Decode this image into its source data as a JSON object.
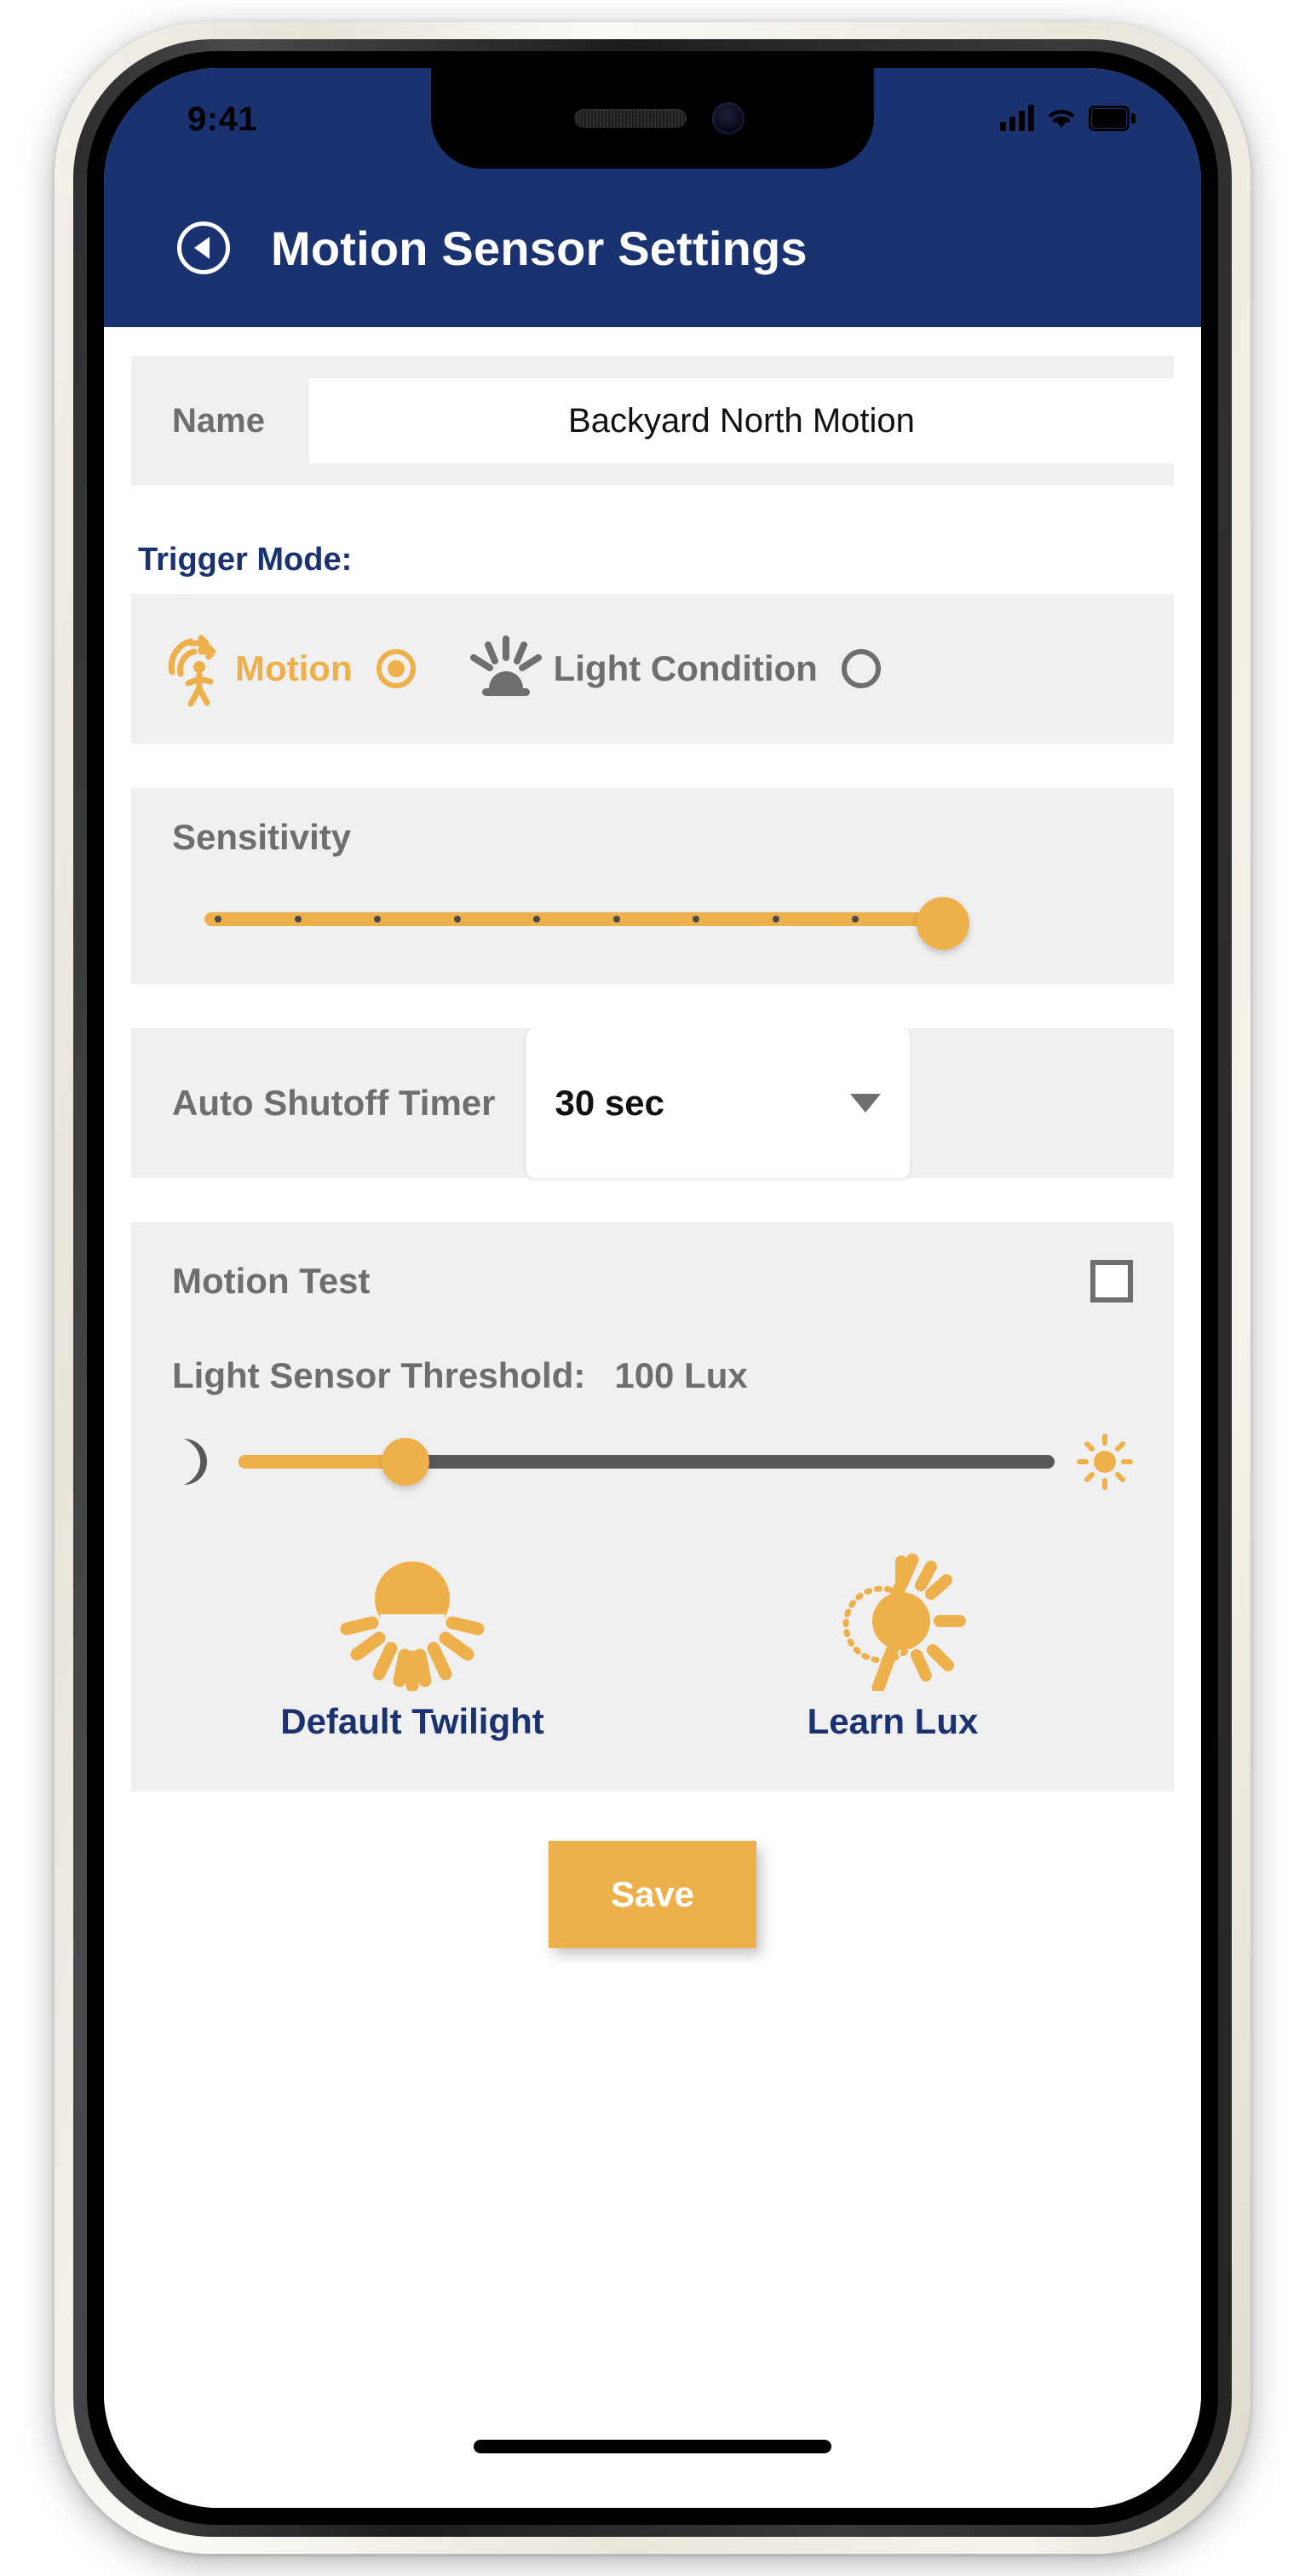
{
  "status_bar": {
    "time": "9:41",
    "signal_icon": "cellular-signal-icon",
    "wifi_icon": "wifi-icon",
    "battery_icon": "battery-full-icon"
  },
  "header": {
    "back_icon": "back-chevron-icon",
    "title": "Motion Sensor Settings",
    "background_color": "#1a3270"
  },
  "name_row": {
    "label": "Name",
    "value": "Backyard North Motion",
    "placeholder": "Backyard North Motion"
  },
  "trigger_mode": {
    "section_label": "Trigger Mode:",
    "options": [
      {
        "label": "Motion",
        "icon": "walking-person-motion-icon",
        "selected": true,
        "color": "#eeb04a"
      },
      {
        "label": "Light Condition",
        "icon": "sunrise-icon",
        "selected": false,
        "color": "#6e6e6e"
      }
    ]
  },
  "sensitivity": {
    "label": "Sensitivity",
    "value_percent": 100,
    "tick_count": 10,
    "track_color": "#eeb04a"
  },
  "auto_shutoff": {
    "label": "Auto Shutoff Timer",
    "value": "30 sec",
    "caret_icon": "chevron-down-icon"
  },
  "motion_test": {
    "label": "Motion Test",
    "checked": false,
    "checkbox_icon": "checkbox-unchecked-icon"
  },
  "light_threshold": {
    "label": "Light Sensor Threshold:",
    "value": "100 Lux",
    "slider_percent": 20,
    "min_icon": "moon-icon",
    "max_icon": "sun-icon",
    "fill_color": "#eeb04a",
    "track_color": "#585858"
  },
  "threshold_actions": [
    {
      "label": "Default Twilight",
      "icon": "dusk-sun-icon"
    },
    {
      "label": "Learn Lux",
      "icon": "sun-clock-learn-icon"
    }
  ],
  "save": {
    "label": "Save",
    "background_color": "#eeb04a"
  },
  "theme": {
    "navy": "#1a3270",
    "orange": "#eeb04a",
    "gray_text": "#6e6e6e",
    "card_bg": "#f0f0f0"
  }
}
